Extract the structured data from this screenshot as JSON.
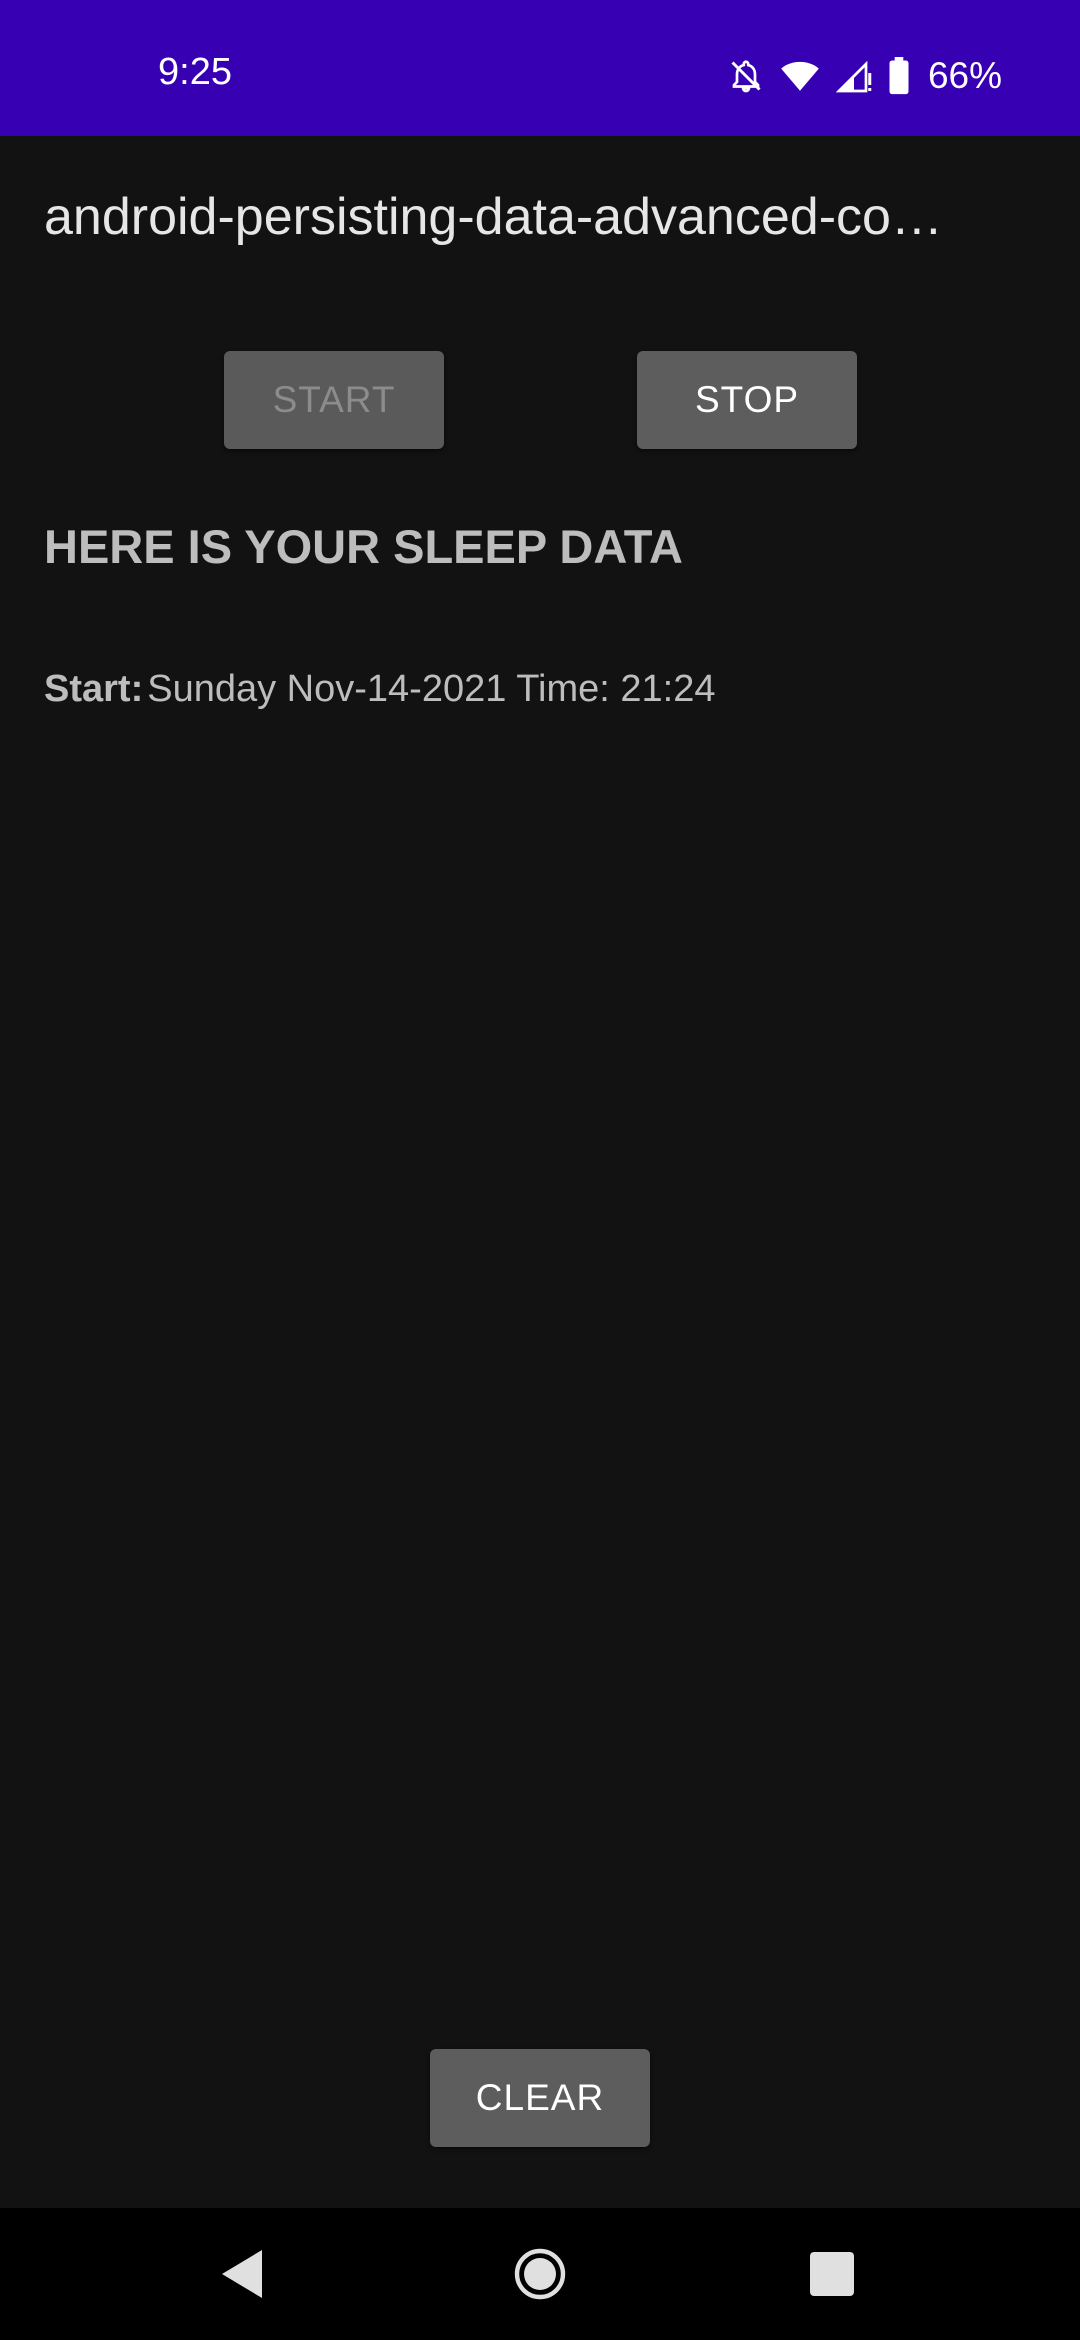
{
  "status_bar": {
    "time": "9:25",
    "battery": "66%",
    "icons": [
      "notifications-off-icon",
      "wifi-icon",
      "cellular-signal-icon",
      "battery-icon"
    ],
    "background_color": "#3700b3"
  },
  "app": {
    "title": "android-persisting-data-advanced-co…"
  },
  "controls": {
    "start_label": "START",
    "stop_label": "STOP",
    "clear_label": "CLEAR"
  },
  "sleep_data": {
    "heading": "HERE IS YOUR SLEEP DATA",
    "entries": [
      {
        "label": "Start:",
        "value": "Sunday Nov-14-2021 Time: 21:24"
      }
    ]
  },
  "nav_bar": {
    "buttons": [
      "back-icon",
      "home-icon",
      "recents-icon"
    ]
  }
}
